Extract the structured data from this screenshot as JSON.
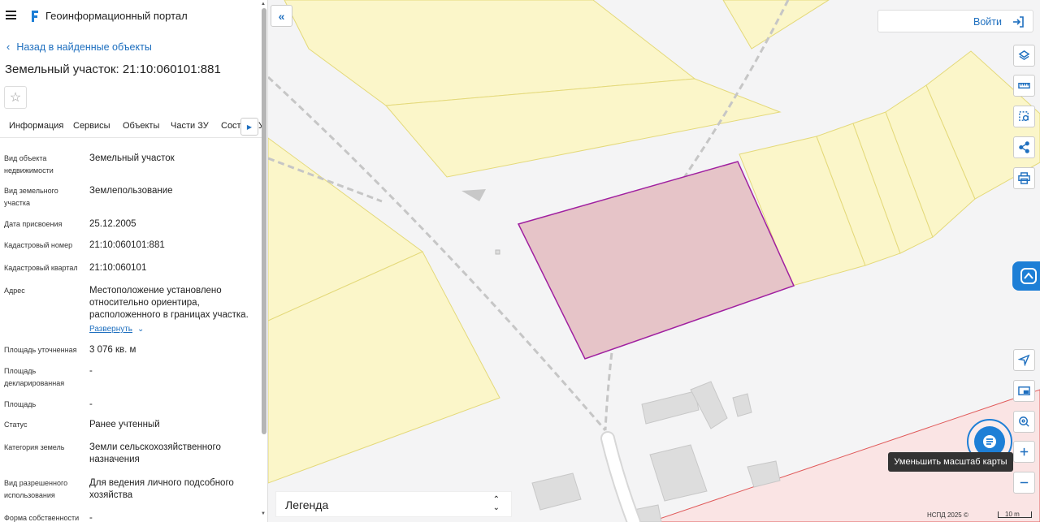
{
  "header": {
    "portal_title": "Геоинформационный портал"
  },
  "panel": {
    "back_label": "Назад в найденные объекты",
    "object_title": "Земельный участок: 21:10:060101:881",
    "favorite_icon": "star-icon",
    "tabs": [
      "Информация",
      "Сервисы",
      "Объекты",
      "Части ЗУ",
      "Состав ЗУ"
    ],
    "properties": [
      {
        "label": "Вид объекта недвижимости",
        "value": "Земельный участок"
      },
      {
        "label": "Вид земельного участка",
        "value": "Землепользование"
      },
      {
        "label": "Дата присвоения",
        "value": "25.12.2005"
      },
      {
        "label": "Кадастровый номер",
        "value": "21:10:060101:881"
      },
      {
        "label": "Кадастровый квартал",
        "value": "21:10:060101"
      },
      {
        "label": "Адрес",
        "value": "Местоположение установлено относительно ориентира, расположенного в границах участка."
      },
      {
        "label": "Площадь уточненная",
        "value": "3 076 кв. м"
      },
      {
        "label": "Площадь декларированная",
        "value": "-"
      },
      {
        "label": "Площадь",
        "value": "-"
      },
      {
        "label": "Статус",
        "value": "Ранее учтенный"
      },
      {
        "label": "Категория земель",
        "value": "Земли сельскохозяйственного назначения"
      },
      {
        "label": "Вид разрешенного использования",
        "value": "Для ведения личного подсобного хозяйства"
      },
      {
        "label": "Форма собственности",
        "value": "-"
      }
    ],
    "address_expand": "Развернуть"
  },
  "map": {
    "login_label": "Войти",
    "legend_label": "Легенда",
    "tooltip": "Уменьшить масштаб карты",
    "attribution": "НСПД 2025 ©",
    "scale_label": "10 m",
    "colors": {
      "accent": "#1e7fd6",
      "parcel_fill": "#e6c4c8",
      "parcel_stroke": "#a020a0",
      "plot_fill": "#fbf6c9",
      "plot_stroke": "#e4d97a"
    },
    "tools": [
      "layers-icon",
      "ruler-icon",
      "select-area-icon",
      "share-icon",
      "print-icon",
      "locate-icon",
      "minimap-icon",
      "geo-search-icon",
      "zoom-in-icon",
      "zoom-out-icon"
    ]
  }
}
